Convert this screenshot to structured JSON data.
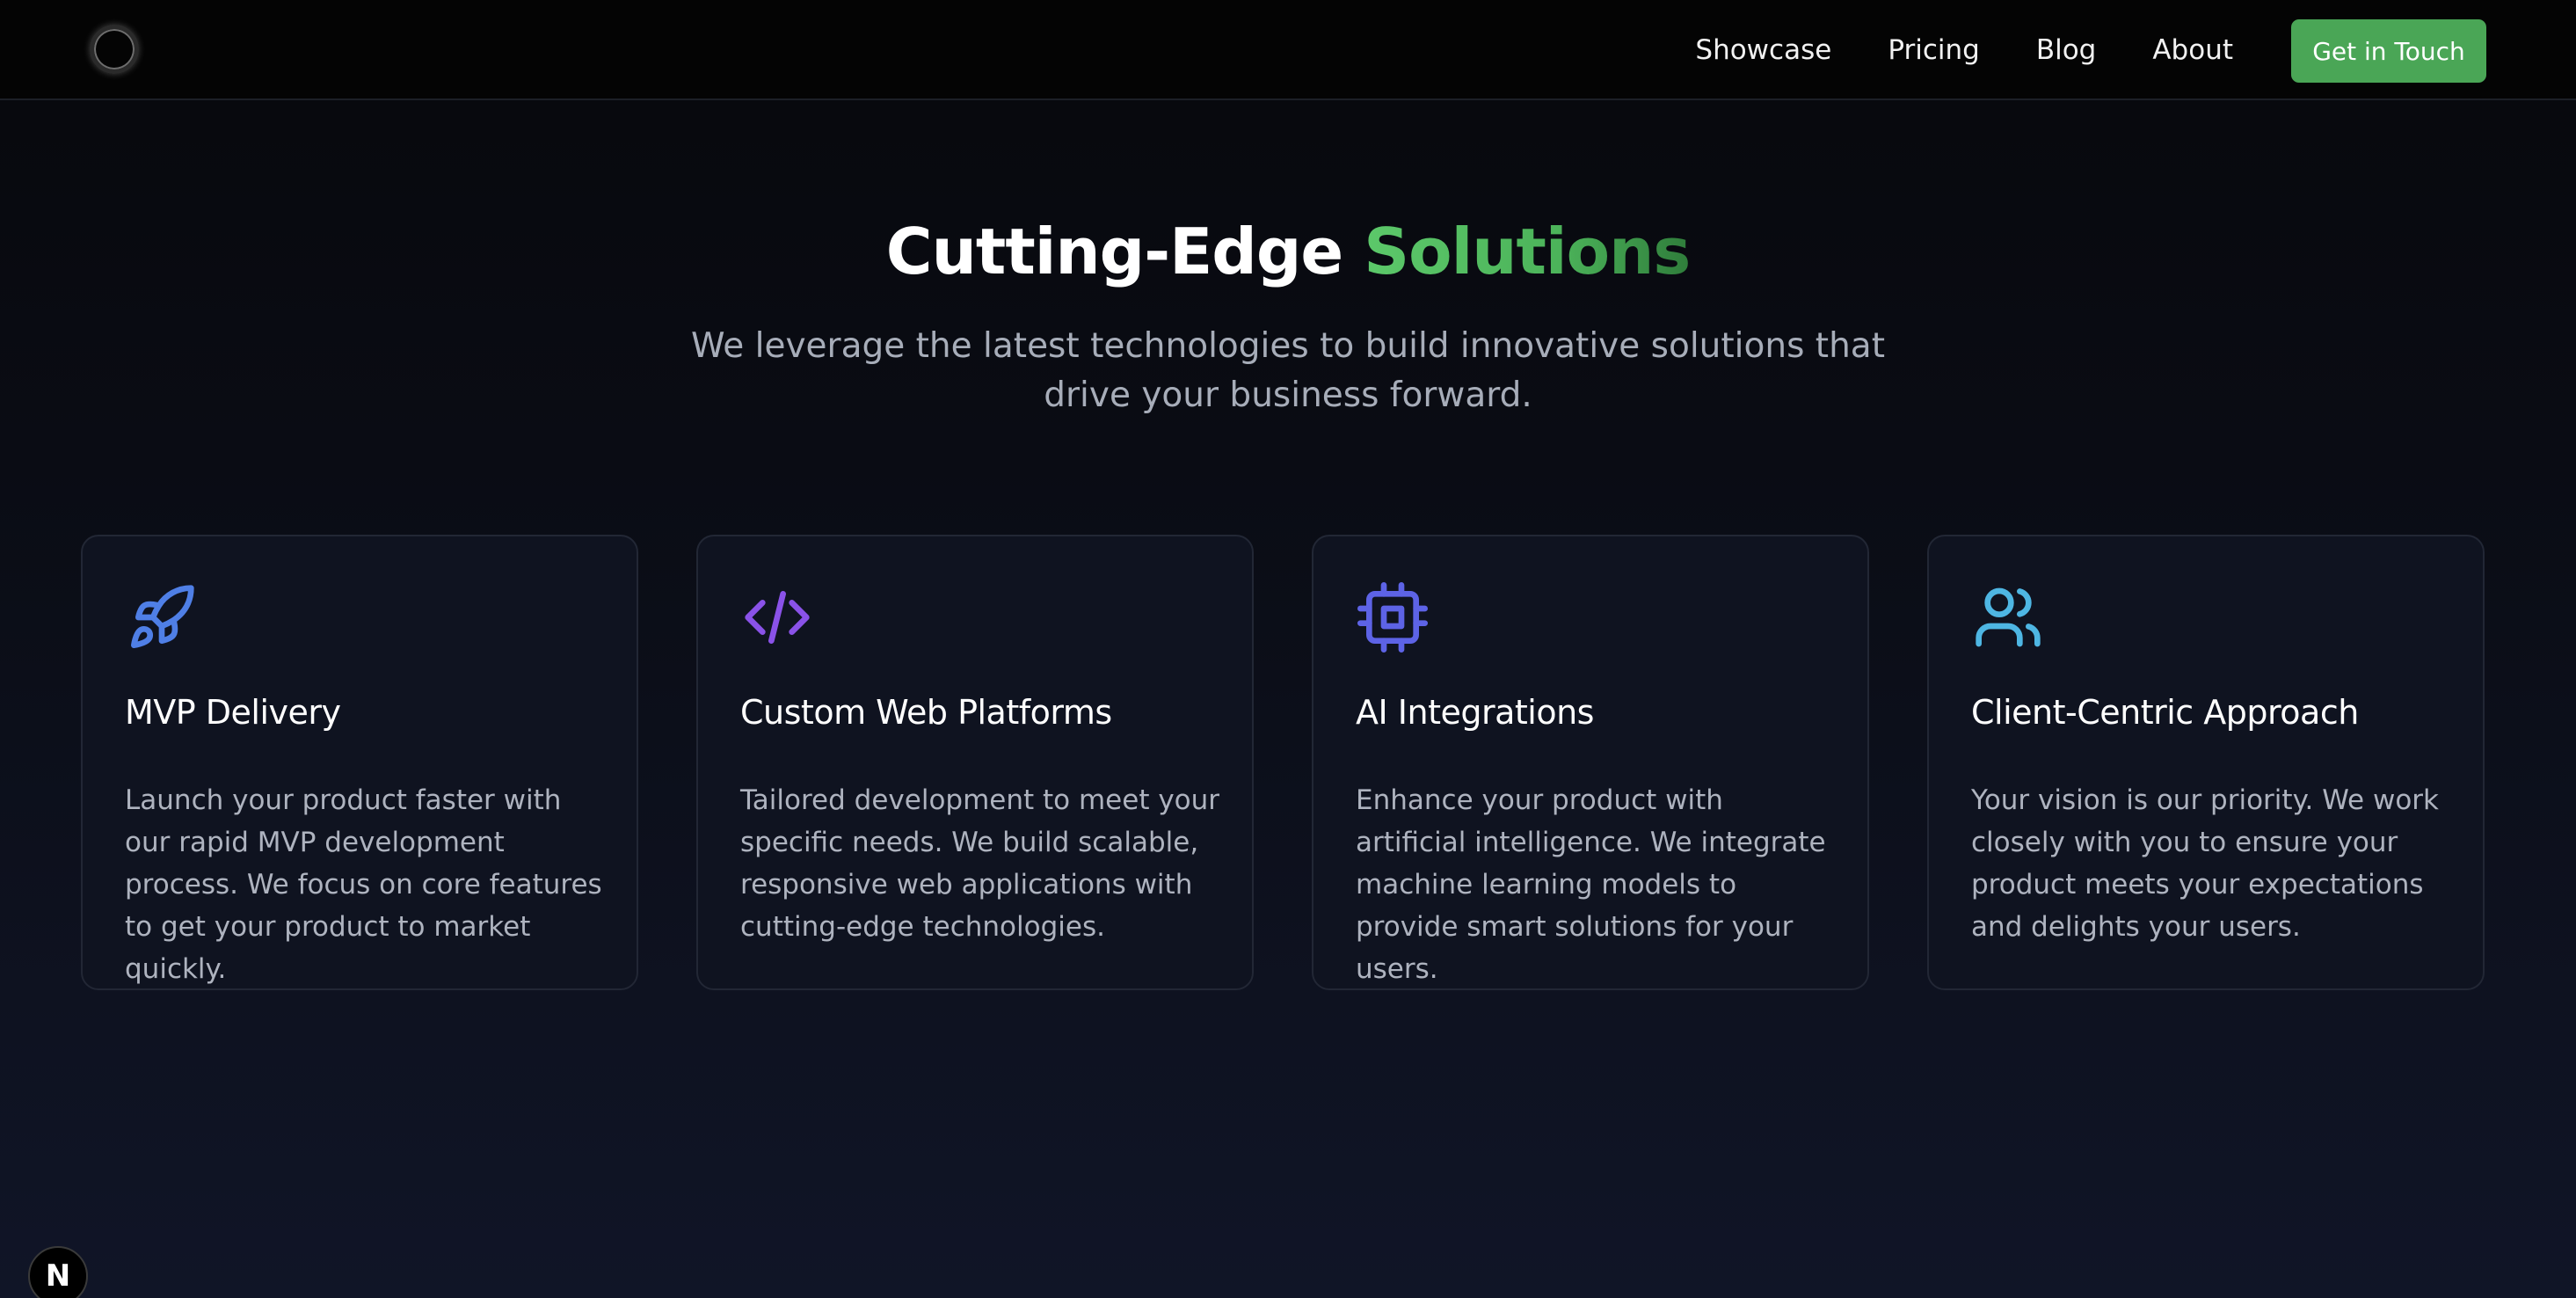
{
  "nav": {
    "links": [
      "Showcase",
      "Pricing",
      "Blog",
      "About"
    ],
    "cta_label": "Get in Touch"
  },
  "hero": {
    "title_main": "Cutting-Edge ",
    "title_accent": "Solutions",
    "subtitle": "We leverage the latest technologies to build innovative solutions that drive your business forward."
  },
  "cards": [
    {
      "icon": "rocket-icon",
      "title": "MVP Delivery",
      "description": "Launch your product faster with our rapid MVP development process. We focus on core features to get your product to market quickly."
    },
    {
      "icon": "code-icon",
      "title": "Custom Web Platforms",
      "description": "Tailored development to meet your specific needs. We build scalable, responsive web applications with cutting-edge technologies."
    },
    {
      "icon": "cpu-chip-icon",
      "title": "AI Integrations",
      "description": "Enhance your product with artificial intelligence. We integrate machine learning models to provide smart solutions for your users."
    },
    {
      "icon": "users-icon",
      "title": "Client-Centric Approach",
      "description": "Your vision is our priority. We work closely with you to ensure your product meets your expectations and delights your users."
    }
  ],
  "badge": {
    "label": "N"
  },
  "colors": {
    "accent_green": "#4aa656",
    "rocket_icon": "#4f7fe6",
    "code_icon": "#8a52e8",
    "chip_icon": "#5d63e6",
    "users_icon": "#4eb6e3"
  }
}
